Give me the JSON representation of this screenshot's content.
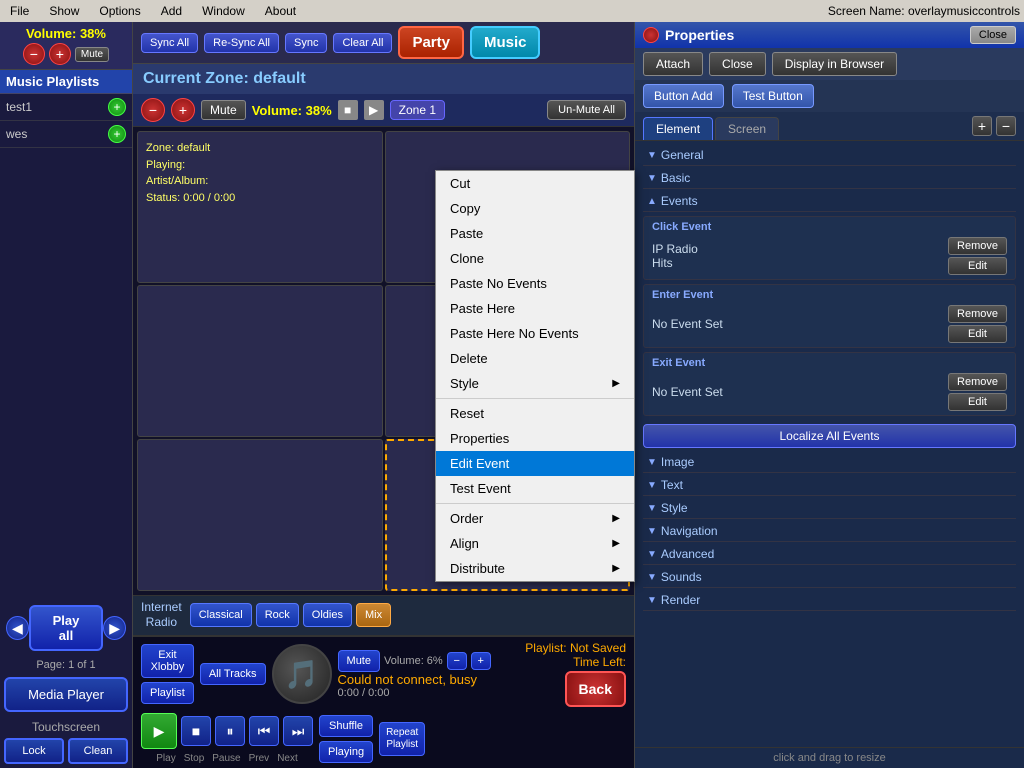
{
  "menubar": {
    "items": [
      "File",
      "Show",
      "Options",
      "Add",
      "Window",
      "About"
    ],
    "screen_name": "Screen Name: overlaymusiccontrols"
  },
  "sidebar": {
    "volume_label": "Volume: 38%",
    "mute_label": "Mute",
    "playlists_header": "Music Playlists",
    "playlists": [
      {
        "name": "test1"
      },
      {
        "name": "wes"
      }
    ],
    "play_all_label": "Play all",
    "page_info": "Page: 1 of 1",
    "media_player_label": "Media Player",
    "touchscreen_label": "Touchscreen",
    "lock_label": "Lock",
    "clean_label": "Clean"
  },
  "zone": {
    "header": "Current Zone: default",
    "volume": "Volume: 38%",
    "mute": "Mute",
    "zone_label": "Zone 1",
    "zone_info_line1": "Zone: default",
    "zone_info_line2": "Playing:",
    "zone_info_line3": "Artist/Album:",
    "zone_info_line4": "Status: 0:00 / 0:00",
    "unmute_all": "Un-Mute All"
  },
  "top_controls": {
    "sync_all": "Sync All",
    "re_sync_all": "Re-Sync All",
    "sync": "Sync",
    "clear_all": "Clear All",
    "party": "Party",
    "music": "Music"
  },
  "internet_radio": {
    "label": "Internet\nRadio",
    "buttons": [
      "Classical",
      "Rock",
      "Oldies",
      "Mix"
    ]
  },
  "bottom_player": {
    "exit_label": "Exit\nXlobby",
    "playlist_label": "Playlist",
    "all_tracks_label": "All Tracks",
    "shuffle_label": "Shuffle",
    "playing_label": "Playing",
    "mute_label": "Mute",
    "track_info": "Could not connect, busy",
    "playlist_status": "Playlist: Not Saved",
    "time_left": "Time Left:",
    "back_label": "Back",
    "transport_labels": [
      "Play",
      "Stop",
      "Pause",
      "Prev",
      "Next"
    ],
    "repeat_label": "Repeat\nPlaylist",
    "time_display": "0:00 / 0:00",
    "volume_label": "Volume: 6%"
  },
  "properties": {
    "title": "Properties",
    "close_label": "Close",
    "attach_label": "Attach",
    "display_browser_label": "Display in Browser",
    "button_add_label": "Button Add",
    "test_button_label": "Test Button",
    "tab_element": "Element",
    "tab_screen": "Screen",
    "sections": [
      {
        "label": "General"
      },
      {
        "label": "Basic"
      },
      {
        "label": "Events"
      }
    ],
    "click_event_label": "Click Event",
    "click_event_name": "IP Radio\nHits",
    "enter_event_label": "Enter Event",
    "enter_event_name": "No Event Set",
    "exit_event_label": "Exit Event",
    "exit_event_name": "No Event Set",
    "remove_label": "Remove",
    "edit_label": "Edit",
    "localize_label": "Localize All Events",
    "lower_sections": [
      "Image",
      "Text",
      "Style",
      "Navigation",
      "Advanced",
      "Sounds",
      "Render"
    ],
    "resize_hint": "click and drag to resize"
  },
  "context_menu": {
    "items": [
      {
        "label": "Cut",
        "highlighted": false
      },
      {
        "label": "Copy",
        "highlighted": false
      },
      {
        "label": "Paste",
        "highlighted": false
      },
      {
        "label": "Clone",
        "highlighted": false
      },
      {
        "label": "Paste No Events",
        "highlighted": false
      },
      {
        "label": "Paste Here",
        "highlighted": false
      },
      {
        "label": "Paste Here No Events",
        "highlighted": false
      },
      {
        "label": "Delete",
        "highlighted": false
      },
      {
        "label": "Style",
        "highlighted": false,
        "submenu": true
      },
      {
        "divider": true
      },
      {
        "label": "Reset",
        "highlighted": false
      },
      {
        "label": "Properties",
        "highlighted": false
      },
      {
        "label": "Edit Event",
        "highlighted": true
      },
      {
        "label": "Test Event",
        "highlighted": false
      },
      {
        "divider": true
      },
      {
        "label": "Order",
        "highlighted": false,
        "submenu": true
      },
      {
        "label": "Align",
        "highlighted": false,
        "submenu": true
      },
      {
        "label": "Distribute",
        "highlighted": false,
        "submenu": true
      }
    ]
  }
}
